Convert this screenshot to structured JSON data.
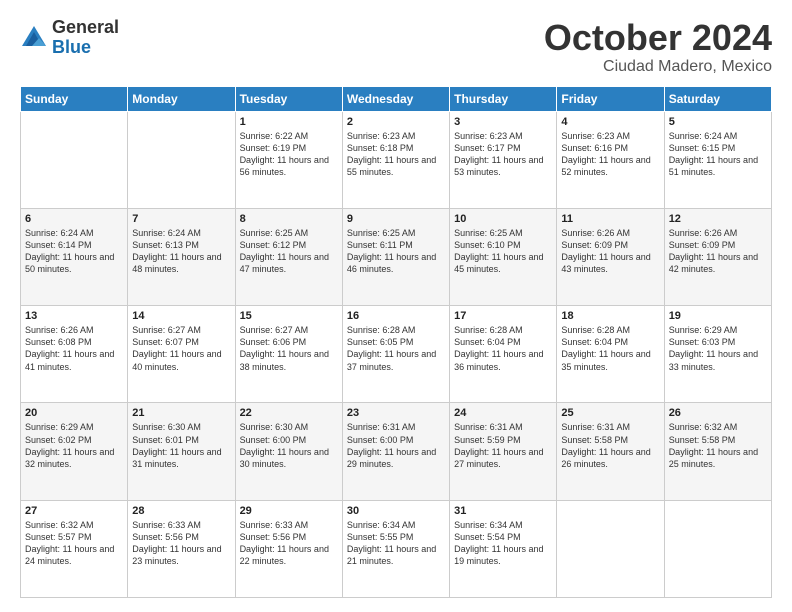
{
  "logo": {
    "general": "General",
    "blue": "Blue"
  },
  "title": "October 2024",
  "subtitle": "Ciudad Madero, Mexico",
  "headers": [
    "Sunday",
    "Monday",
    "Tuesday",
    "Wednesday",
    "Thursday",
    "Friday",
    "Saturday"
  ],
  "weeks": [
    [
      {
        "day": "",
        "info": ""
      },
      {
        "day": "",
        "info": ""
      },
      {
        "day": "1",
        "info": "Sunrise: 6:22 AM\nSunset: 6:19 PM\nDaylight: 11 hours and 56 minutes."
      },
      {
        "day": "2",
        "info": "Sunrise: 6:23 AM\nSunset: 6:18 PM\nDaylight: 11 hours and 55 minutes."
      },
      {
        "day": "3",
        "info": "Sunrise: 6:23 AM\nSunset: 6:17 PM\nDaylight: 11 hours and 53 minutes."
      },
      {
        "day": "4",
        "info": "Sunrise: 6:23 AM\nSunset: 6:16 PM\nDaylight: 11 hours and 52 minutes."
      },
      {
        "day": "5",
        "info": "Sunrise: 6:24 AM\nSunset: 6:15 PM\nDaylight: 11 hours and 51 minutes."
      }
    ],
    [
      {
        "day": "6",
        "info": "Sunrise: 6:24 AM\nSunset: 6:14 PM\nDaylight: 11 hours and 50 minutes."
      },
      {
        "day": "7",
        "info": "Sunrise: 6:24 AM\nSunset: 6:13 PM\nDaylight: 11 hours and 48 minutes."
      },
      {
        "day": "8",
        "info": "Sunrise: 6:25 AM\nSunset: 6:12 PM\nDaylight: 11 hours and 47 minutes."
      },
      {
        "day": "9",
        "info": "Sunrise: 6:25 AM\nSunset: 6:11 PM\nDaylight: 11 hours and 46 minutes."
      },
      {
        "day": "10",
        "info": "Sunrise: 6:25 AM\nSunset: 6:10 PM\nDaylight: 11 hours and 45 minutes."
      },
      {
        "day": "11",
        "info": "Sunrise: 6:26 AM\nSunset: 6:09 PM\nDaylight: 11 hours and 43 minutes."
      },
      {
        "day": "12",
        "info": "Sunrise: 6:26 AM\nSunset: 6:09 PM\nDaylight: 11 hours and 42 minutes."
      }
    ],
    [
      {
        "day": "13",
        "info": "Sunrise: 6:26 AM\nSunset: 6:08 PM\nDaylight: 11 hours and 41 minutes."
      },
      {
        "day": "14",
        "info": "Sunrise: 6:27 AM\nSunset: 6:07 PM\nDaylight: 11 hours and 40 minutes."
      },
      {
        "day": "15",
        "info": "Sunrise: 6:27 AM\nSunset: 6:06 PM\nDaylight: 11 hours and 38 minutes."
      },
      {
        "day": "16",
        "info": "Sunrise: 6:28 AM\nSunset: 6:05 PM\nDaylight: 11 hours and 37 minutes."
      },
      {
        "day": "17",
        "info": "Sunrise: 6:28 AM\nSunset: 6:04 PM\nDaylight: 11 hours and 36 minutes."
      },
      {
        "day": "18",
        "info": "Sunrise: 6:28 AM\nSunset: 6:04 PM\nDaylight: 11 hours and 35 minutes."
      },
      {
        "day": "19",
        "info": "Sunrise: 6:29 AM\nSunset: 6:03 PM\nDaylight: 11 hours and 33 minutes."
      }
    ],
    [
      {
        "day": "20",
        "info": "Sunrise: 6:29 AM\nSunset: 6:02 PM\nDaylight: 11 hours and 32 minutes."
      },
      {
        "day": "21",
        "info": "Sunrise: 6:30 AM\nSunset: 6:01 PM\nDaylight: 11 hours and 31 minutes."
      },
      {
        "day": "22",
        "info": "Sunrise: 6:30 AM\nSunset: 6:00 PM\nDaylight: 11 hours and 30 minutes."
      },
      {
        "day": "23",
        "info": "Sunrise: 6:31 AM\nSunset: 6:00 PM\nDaylight: 11 hours and 29 minutes."
      },
      {
        "day": "24",
        "info": "Sunrise: 6:31 AM\nSunset: 5:59 PM\nDaylight: 11 hours and 27 minutes."
      },
      {
        "day": "25",
        "info": "Sunrise: 6:31 AM\nSunset: 5:58 PM\nDaylight: 11 hours and 26 minutes."
      },
      {
        "day": "26",
        "info": "Sunrise: 6:32 AM\nSunset: 5:58 PM\nDaylight: 11 hours and 25 minutes."
      }
    ],
    [
      {
        "day": "27",
        "info": "Sunrise: 6:32 AM\nSunset: 5:57 PM\nDaylight: 11 hours and 24 minutes."
      },
      {
        "day": "28",
        "info": "Sunrise: 6:33 AM\nSunset: 5:56 PM\nDaylight: 11 hours and 23 minutes."
      },
      {
        "day": "29",
        "info": "Sunrise: 6:33 AM\nSunset: 5:56 PM\nDaylight: 11 hours and 22 minutes."
      },
      {
        "day": "30",
        "info": "Sunrise: 6:34 AM\nSunset: 5:55 PM\nDaylight: 11 hours and 21 minutes."
      },
      {
        "day": "31",
        "info": "Sunrise: 6:34 AM\nSunset: 5:54 PM\nDaylight: 11 hours and 19 minutes."
      },
      {
        "day": "",
        "info": ""
      },
      {
        "day": "",
        "info": ""
      }
    ]
  ]
}
